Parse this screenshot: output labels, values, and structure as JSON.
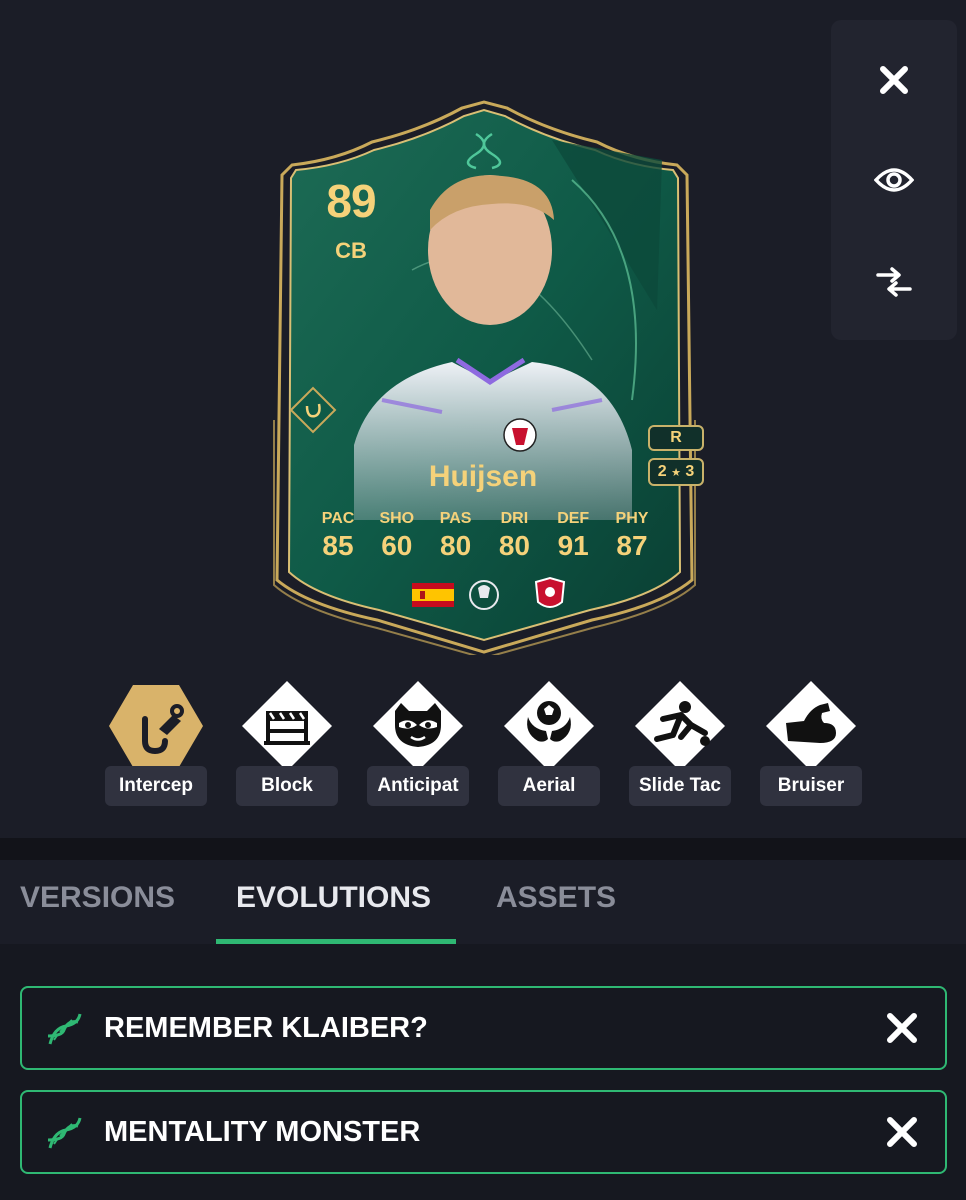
{
  "toolbar": {
    "close_icon": "close-icon",
    "preview_icon": "eye-icon",
    "compare_icon": "compare-arrows-icon"
  },
  "card": {
    "rating": "89",
    "position": "CB",
    "name": "Huijsen",
    "preferred_foot": "R",
    "skill_moves": "2",
    "weak_foot": "3",
    "stats": [
      {
        "label": "PAC",
        "value": "85"
      },
      {
        "label": "SHO",
        "value": "60"
      },
      {
        "label": "PAS",
        "value": "80"
      },
      {
        "label": "DRI",
        "value": "80"
      },
      {
        "label": "DEF",
        "value": "91"
      },
      {
        "label": "PHY",
        "value": "87"
      }
    ],
    "nation": "spain-flag-icon",
    "league": "premier-league-icon",
    "club": "bournemouth-crest-icon",
    "colors": {
      "card_green": "#0f5a47",
      "gold": "#f5d27a",
      "frame": "#c9a95a"
    }
  },
  "playstyles": [
    {
      "label": "Intercep",
      "icon": "interception-icon",
      "plus": true
    },
    {
      "label": "Block",
      "icon": "block-icon",
      "plus": false
    },
    {
      "label": "Anticipat",
      "icon": "raccoon-icon",
      "plus": false
    },
    {
      "label": "Aerial",
      "icon": "ball-wings-icon",
      "plus": false
    },
    {
      "label": "Slide Tac",
      "icon": "slide-tackle-icon",
      "plus": false
    },
    {
      "label": "Bruiser",
      "icon": "muscle-arm-icon",
      "plus": false
    }
  ],
  "tabs": [
    {
      "label": "VERSIONS",
      "active": false
    },
    {
      "label": "EVOLUTIONS",
      "active": true
    },
    {
      "label": "ASSETS",
      "active": false
    }
  ],
  "evolutions": [
    {
      "name": "REMEMBER KLAIBER?"
    },
    {
      "name": "MENTALITY MONSTER"
    }
  ],
  "accent_color": "#2fb873"
}
